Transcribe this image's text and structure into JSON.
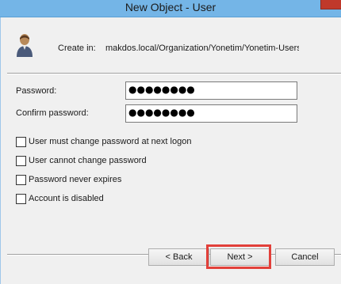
{
  "window": {
    "title": "New Object - User"
  },
  "create_in": {
    "label": "Create in:",
    "path": "makdos.local/Organization/Yonetim/Yonetim-Users"
  },
  "fields": {
    "password": {
      "label": "Password:",
      "value": "●●●●●●●●"
    },
    "confirm_password": {
      "label": "Confirm password:",
      "value": "●●●●●●●●"
    }
  },
  "options": [
    {
      "label": "User must change password at next logon",
      "checked": false
    },
    {
      "label": "User cannot change password",
      "checked": false
    },
    {
      "label": "Password never expires",
      "checked": false
    },
    {
      "label": "Account is disabled",
      "checked": false
    }
  ],
  "buttons": {
    "back": "< Back",
    "next": "Next >",
    "cancel": "Cancel"
  },
  "icons": {
    "user": "user-icon",
    "close": "close-icon"
  },
  "colors": {
    "titlebar": "#74b5e7",
    "highlight": "#e2403a",
    "close": "#c0392b"
  }
}
